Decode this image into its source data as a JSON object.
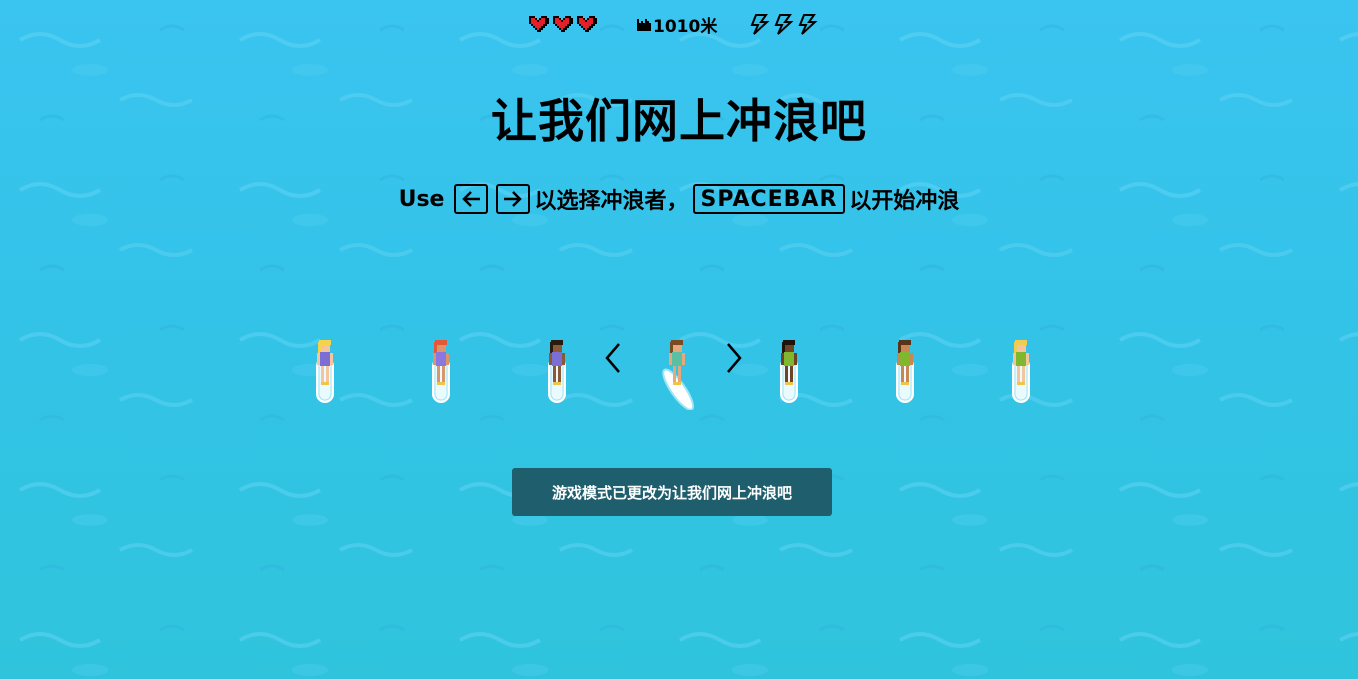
{
  "hud": {
    "lives": 3,
    "distance": "1010米",
    "boosts": 3,
    "heart_color": "#e5202b",
    "bolt_color": "#000000"
  },
  "title": "让我们网上冲浪吧",
  "instructions": {
    "use": "Use",
    "left_key": "←",
    "right_key": "→",
    "choose_text": "以选择冲浪者，",
    "spacebar_key": "SPACEBAR",
    "start_text": "以开始冲浪"
  },
  "surfers": [
    {
      "name": "surfer-1",
      "hair": "#f5d24a",
      "skin": "#f4c49c",
      "outfit": "#7b6fd6"
    },
    {
      "name": "surfer-2",
      "hair": "#e2583a",
      "skin": "#d9956b",
      "outfit": "#8a78e0"
    },
    {
      "name": "surfer-3",
      "hair": "#2b1a10",
      "skin": "#8a5a35",
      "outfit": "#7b6fd6"
    },
    {
      "name": "surfer-4-selected",
      "hair": "#7a4a22",
      "skin": "#e3a97a",
      "outfit": "#5bc0a3"
    },
    {
      "name": "surfer-5",
      "hair": "#1e140c",
      "skin": "#6f4424",
      "outfit": "#7fb82f"
    },
    {
      "name": "surfer-6",
      "hair": "#5a3418",
      "skin": "#c98552",
      "outfit": "#7fb82f"
    },
    {
      "name": "surfer-7",
      "hair": "#f0cc52",
      "skin": "#f4c49c",
      "outfit": "#7fb82f"
    }
  ],
  "toast": "游戏模式已更改为让我们网上冲浪吧",
  "colors": {
    "ocean": "#36c3ea",
    "toast_bg": "#1f5e6d"
  }
}
